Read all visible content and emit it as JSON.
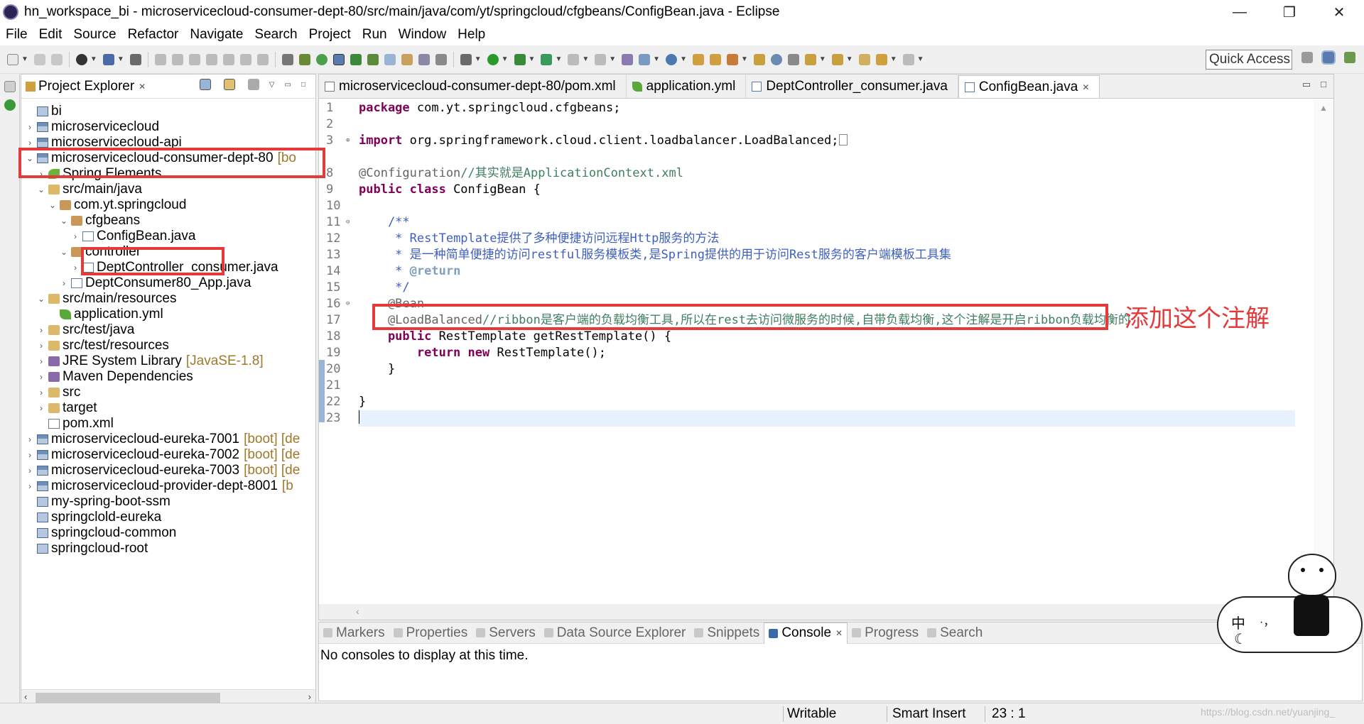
{
  "window": {
    "title": "hn_workspace_bi - microservicecloud-consumer-dept-80/src/main/java/com/yt/springcloud/cfgbeans/ConfigBean.java - Eclipse",
    "minimize": "—",
    "maximize": "❐",
    "close": "✕"
  },
  "menu": [
    "File",
    "Edit",
    "Source",
    "Refactor",
    "Navigate",
    "Search",
    "Project",
    "Run",
    "Window",
    "Help"
  ],
  "toolbar": {
    "quick_access": "Quick Access"
  },
  "explorer": {
    "title": "Project Explorer",
    "close": "✕",
    "rows": [
      {
        "label": "bi",
        "decor": "",
        "icon": "plain-project",
        "twisty": ""
      },
      {
        "label": "microservicecloud",
        "decor": "",
        "icon": "maven-project",
        "twisty": "›"
      },
      {
        "label": "microservicecloud-api",
        "decor": "",
        "icon": "maven-project",
        "twisty": "›"
      },
      {
        "label": "microservicecloud-consumer-dept-80",
        "decor": "[bo",
        "icon": "maven-project",
        "twisty": "⌄"
      },
      {
        "label": "Spring Elements",
        "decor": "",
        "icon": "spring",
        "twisty": "›"
      },
      {
        "label": "src/main/java",
        "decor": "",
        "icon": "source-folder",
        "twisty": "⌄"
      },
      {
        "label": "com.yt.springcloud",
        "decor": "",
        "icon": "package",
        "twisty": "⌄"
      },
      {
        "label": "cfgbeans",
        "decor": "",
        "icon": "package",
        "twisty": "⌄"
      },
      {
        "label": "ConfigBean.java",
        "decor": "",
        "icon": "java-file",
        "twisty": "›"
      },
      {
        "label": "controller",
        "decor": "",
        "icon": "package",
        "twisty": "⌄"
      },
      {
        "label": "DeptController_consumer.java",
        "decor": "",
        "icon": "java-file",
        "twisty": "›"
      },
      {
        "label": "DeptConsumer80_App.java",
        "decor": "",
        "icon": "java-file",
        "twisty": "›"
      },
      {
        "label": "src/main/resources",
        "decor": "",
        "icon": "source-folder",
        "twisty": "⌄"
      },
      {
        "label": "application.yml",
        "decor": "",
        "icon": "yml-file",
        "twisty": ""
      },
      {
        "label": "src/test/java",
        "decor": "",
        "icon": "source-folder",
        "twisty": "›"
      },
      {
        "label": "src/test/resources",
        "decor": "",
        "icon": "source-folder",
        "twisty": "›"
      },
      {
        "label": "JRE System Library",
        "decor": "[JavaSE-1.8]",
        "icon": "library",
        "twisty": "›"
      },
      {
        "label": "Maven Dependencies",
        "decor": "",
        "icon": "library",
        "twisty": "›"
      },
      {
        "label": "src",
        "decor": "",
        "icon": "folder",
        "twisty": "›"
      },
      {
        "label": "target",
        "decor": "",
        "icon": "folder",
        "twisty": "›"
      },
      {
        "label": "pom.xml",
        "decor": "",
        "icon": "xml-file",
        "twisty": ""
      },
      {
        "label": "microservicecloud-eureka-7001",
        "decor": "[boot] [de",
        "icon": "maven-project",
        "twisty": "›"
      },
      {
        "label": "microservicecloud-eureka-7002",
        "decor": "[boot] [de",
        "icon": "maven-project",
        "twisty": "›"
      },
      {
        "label": "microservicecloud-eureka-7003",
        "decor": "[boot] [de",
        "icon": "maven-project",
        "twisty": "›"
      },
      {
        "label": "microservicecloud-provider-dept-8001",
        "decor": "[b",
        "icon": "maven-project",
        "twisty": "›"
      },
      {
        "label": "my-spring-boot-ssm",
        "decor": "",
        "icon": "plain-project",
        "twisty": ""
      },
      {
        "label": "springclold-eureka",
        "decor": "",
        "icon": "plain-project",
        "twisty": ""
      },
      {
        "label": "springcloud-common",
        "decor": "",
        "icon": "plain-project",
        "twisty": ""
      },
      {
        "label": "springcloud-root",
        "decor": "",
        "icon": "plain-project",
        "twisty": ""
      }
    ]
  },
  "editor": {
    "tabs": [
      {
        "label": "microservicecloud-consumer-dept-80/pom.xml",
        "icon": "xml-file",
        "active": false
      },
      {
        "label": "application.yml",
        "icon": "yml-file",
        "active": false
      },
      {
        "label": "DeptController_consumer.java",
        "icon": "java-file",
        "active": false
      },
      {
        "label": "ConfigBean.java",
        "icon": "java-file",
        "active": true
      }
    ],
    "line_numbers": [
      "1",
      "2",
      "3",
      "8",
      "9",
      "10",
      "11",
      "12",
      "13",
      "14",
      "15",
      "16",
      "17",
      "18",
      "19",
      "20",
      "21",
      "22",
      "23"
    ],
    "lines": {
      "l1_kw": "package",
      "l1_rest": " com.yt.springcloud.cfgbeans;",
      "l3_kw": "import",
      "l3_rest": " org.springframework.cloud.client.loadbalancer.LoadBalanced;",
      "l8_ann": "@Configuration",
      "l8_cmt": "//其实就是ApplicationContext.xml",
      "l9_kw": "public class",
      "l9_rest": " ConfigBean {",
      "l11": "    /**",
      "l12_star": "     * ",
      "l12_text": "RestTemplate提供了多种便捷访问远程Http服务的方法",
      "l13_star": "     * ",
      "l13_text": "是一种简单便捷的访问restful服务模板类,是Spring提供的用于访问Rest服务的客户端模板工具集",
      "l14_star": "     * ",
      "l14_tag": "@return",
      "l15": "     */",
      "l16": "    @Bean",
      "l17_ann": "    @LoadBalanced",
      "l17_cmt": "//ribbon是客户端的负载均衡工具,所以在rest去访问微服务的时候,自带负载均衡,这个注解是开启ribbon负载均衡的",
      "l18_kw": "    public",
      "l18_rest": " RestTemplate getRestTemplate() {",
      "l19_kw": "        return new",
      "l19_rest": " RestTemplate();",
      "l20": "    }",
      "l22": "}"
    }
  },
  "bottom": {
    "tabs": [
      {
        "label": "Markers",
        "active": false
      },
      {
        "label": "Properties",
        "active": false
      },
      {
        "label": "Servers",
        "active": false
      },
      {
        "label": "Data Source Explorer",
        "active": false
      },
      {
        "label": "Snippets",
        "active": false
      },
      {
        "label": "Console",
        "active": true
      },
      {
        "label": "Progress",
        "active": false
      },
      {
        "label": "Search",
        "active": false
      }
    ],
    "console_message": "No consoles to display at this time."
  },
  "status": {
    "writable": "Writable",
    "insert_mode": "Smart Insert",
    "position": "23 : 1"
  },
  "annotation": {
    "callout": "添加这个注解"
  },
  "ime": {
    "chinese": "中",
    "punct": "·，",
    "moon": "☾"
  },
  "watermark": "https://blog.csdn.net/yuanjing_",
  "colors": {
    "highlight_red": "#e53a3a",
    "keyword": "#7f0055",
    "comment": "#3f7f5f",
    "javadoc": "#3f5fbf",
    "current_line": "#e8f2fe"
  }
}
